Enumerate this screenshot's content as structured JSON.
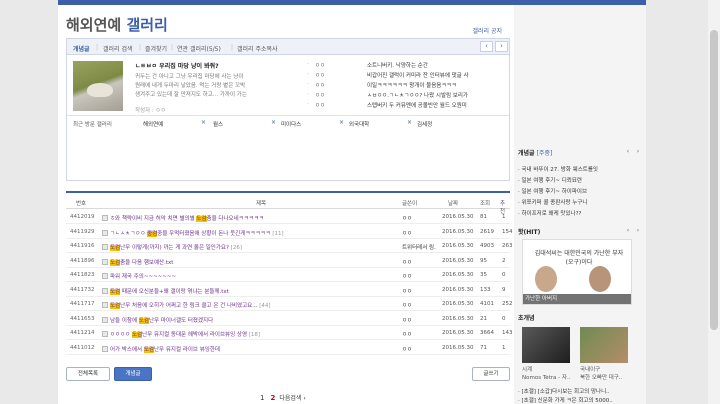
{
  "header": {
    "title_main": "해외연예",
    "title_accent": "갤러리",
    "notice_link": "갤러리 공지"
  },
  "tabs": [
    {
      "label": "개념글",
      "active": true
    },
    {
      "label": "갤러리 검색",
      "active": false
    },
    {
      "label": "즐겨찾기",
      "active": false
    },
    {
      "label": "연관 갤러리(5/5)",
      "active": false
    },
    {
      "label": "갤러리 주소복사",
      "active": false
    }
  ],
  "tab_nav": {
    "prev": "‹",
    "next": "›"
  },
  "featured": {
    "title": "ㄴㅌㅂㅇ 우리집 마당 냥이 봐줘?",
    "lines": [
      "귀두는 건 아니고 그냥 우리집 마당에 사는 냥이",
      "원래에 내게 두마리 낳았음. 먹는 거랑 볕은 꼬박",
      "생겨주고 있는데 잘 만져지도 하고... 가까이 가는"
    ],
    "author": "작성자 : ㅇㅇ"
  },
  "right_list": [
    {
      "who": "ㅇㅇ",
      "what": "소트니버키. 낙양하는 순간"
    },
    {
      "who": "ㅇㅇ",
      "what": "비갑어진 갤럭이 커미라 잔 인터뷰에 댓글 사"
    },
    {
      "who": "ㅇㅇ",
      "what": "이일ㅋㅋㅋㅋㅋㅋ 왕개이 물음음ㅋㅋㅋ"
    },
    {
      "who": "ㅇㅇ",
      "what": "ㅅㅂㅇㅇ.ㄱㄴㅊㄱㅇㅇ? 나왔 시발림 보리가"
    },
    {
      "who": "ㅇㅇ",
      "what": "스텝버키 두 커뮤멘에 공몰빈안 월드 오원미"
    }
  ],
  "visited": {
    "label": "최근 방문 갤러리",
    "tags": [
      "해외연예",
      "월스",
      "미이다스",
      "외국대학",
      "김세정"
    ],
    "close": "×"
  },
  "table_headers": {
    "no": "번호",
    "subject": "제목",
    "author": "글쓴이",
    "date": "날짜",
    "hits": "조회",
    "rec": "추천"
  },
  "posts": [
    {
      "no": "4412019",
      "pre": "ㅎ와 책략이비 지금 허악 치면 별의별 ",
      "hl": "도검",
      "post": "춤을 다나오네ㅋㅋㅋㅋㅋ",
      "cnt": "",
      "author": "ㅇㅇ",
      "date": "2016.05.30",
      "hits": "81",
      "rec": "1"
    },
    {
      "no": "4411929",
      "pre": "ㄱㄴㅅㅊㄱㅇㅇ ",
      "hl": "중검",
      "post": "중을 우먹터졌음애 상황이 돈나 웃긴게ㅋㅋㅋㅋㅋ",
      "cnt": "[11]",
      "author": "ㅇㅇ",
      "date": "2016.05.30",
      "hits": "2619",
      "rec": "154"
    },
    {
      "no": "4411916",
      "pre": "",
      "hl": "도검",
      "post": "난무 이렇게(까지) 까는 게 과연 옳은 일인가요?",
      "cnt": "[26]",
      "author": "트위터레서 링.",
      "date": "2016.05.30",
      "hits": "4903",
      "rec": "263"
    },
    {
      "no": "4411896",
      "pre": "",
      "hl": "도검",
      "post": "춤을 다음 햄보예산.txt",
      "cnt": "",
      "author": "ㅇㅇ",
      "date": "2016.05.30",
      "hits": "95",
      "rec": "2"
    },
    {
      "no": "4411823",
      "pre": "파워 재국 주의~~~~~~~",
      "hl": "",
      "post": "",
      "cnt": "",
      "author": "ㅇㅇ",
      "date": "2016.05.30",
      "hits": "35",
      "rec": "0"
    },
    {
      "no": "4411732",
      "pre": "",
      "hl": "도검",
      "post": " 때문에 오신분들+왜 갤이랑 엮냐는 분들께.txt",
      "cnt": "",
      "author": "ㅇㅇ",
      "date": "2016.05.30",
      "hits": "133",
      "rec": "9"
    },
    {
      "no": "4411717",
      "pre": "",
      "hl": "도검",
      "post": "난무 처음에 오히가 어쩌고 한 링크 클고 온 건 나비였고요...",
      "cnt": "[44]",
      "author": "ㅇㅇ",
      "date": "2016.05.30",
      "hits": "4101",
      "rec": "252"
    },
    {
      "no": "4411653",
      "pre": "남들 이참에 ",
      "hl": "도검",
      "post": "난무 마이너갤도 터졌겠지다",
      "cnt": "",
      "author": "ㅇㅇ",
      "date": "2016.05.30",
      "hits": "21",
      "rec": "0"
    },
    {
      "no": "4411214",
      "pre": "ㅇㅇㅇㅇ ",
      "hl": "도검",
      "post": "난무 뮤지컬 동대문 헤박에서 라이브뷰잉 상영",
      "cnt": "[18]",
      "author": "ㅇㅇ",
      "date": "2016.05.30",
      "hits": "3664",
      "rec": "143"
    },
    {
      "no": "4411012",
      "pre": "어가 박스에서 ",
      "hl": "도검",
      "post": "난무 뮤지컬 라이브 뷰잉한데",
      "cnt": "",
      "author": "ㅇㅇ",
      "date": "2016.05.30",
      "hits": "71",
      "rec": "1"
    }
  ],
  "buttons": {
    "all_posts": "전체목록",
    "featured": "개념글",
    "write": "글쓰기"
  },
  "pager": {
    "page1": "1",
    "page2": "2",
    "next": "다음검색 ›"
  },
  "sidebar": {
    "concept_head": "개념글",
    "concept_sub": "[주중]",
    "concept_items": [
      "· 국내 바뚜이 27. 방화 웨스트를잇",
      "· 일본 여행 후기~ 디뢰묘련",
      "· 일본 여행 후기~ 하이파이브",
      "· 위쪼키퍼 콜 종판사랑 누구니",
      "· 하이프저로 왜케 맛있나??"
    ],
    "hot_head": "핫(HIT)",
    "hot_text": "김대석씨는 대한민국의 가난한 부자(오구)이다",
    "hot_caption": "가난한 아버지",
    "ch_head": "초개념",
    "ch_caps": [
      "시계",
      "Nomos Tetra - 자..",
      "국내이구",
      "북한 오빠만 대구.."
    ],
    "bottom_items": [
      "· [초갤] [소갑]다시보는 회고의 망나니..",
      "· [초갤] 신문화 가게 ㅋ은 회고의 5000.."
    ]
  }
}
